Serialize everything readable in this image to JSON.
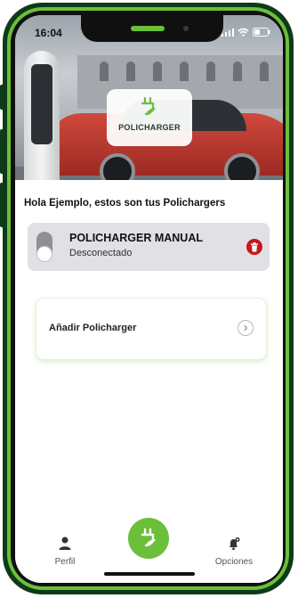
{
  "status_bar": {
    "time": "16:04"
  },
  "hero": {
    "logo_text": "POLICHARGER"
  },
  "greeting": "Hola Ejemplo, estos son tus Polichargers",
  "devices": [
    {
      "name": "POLICHARGER MANUAL",
      "status": "Desconectado"
    }
  ],
  "add_card": {
    "label": "Añadir Policharger"
  },
  "tabbar": {
    "left_label": "Perfil",
    "right_label": "Opciones"
  },
  "colors": {
    "brand_green": "#6bbf3a",
    "frame_dark": "#0e3a18",
    "delete_red": "#c8161d",
    "card_gray": "#e0e0e5"
  },
  "icons": {
    "profile": "person-icon",
    "options": "bell-gear-icon",
    "center": "plug-leaf-icon",
    "delete": "trash-icon",
    "add": "chevron-right-icon"
  }
}
